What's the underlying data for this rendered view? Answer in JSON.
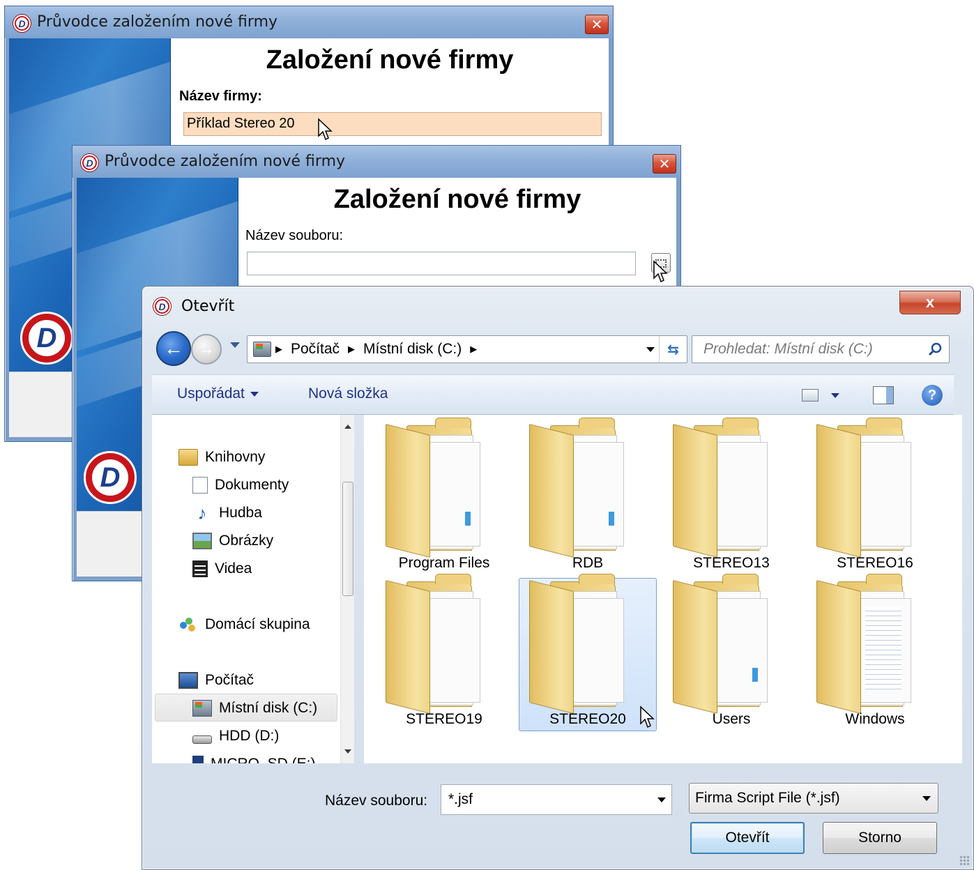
{
  "wizard1": {
    "title": "Průvodce založením nové firmy",
    "heading": "Založení nové firmy",
    "field_label": "Název firmy:",
    "field_value": "Příklad Stereo 20"
  },
  "wizard2": {
    "title": "Průvodce založením nové firmy",
    "heading": "Založení nové firmy",
    "field_label": "Název souboru:",
    "field_value": ""
  },
  "dialog": {
    "title": "Otevřít",
    "close_label": "x",
    "breadcrumb": [
      "Počítač",
      "Místní disk (C:)"
    ],
    "search_placeholder": "Prohledat: Místní disk (C:)",
    "toolbar": {
      "organize": "Uspořádat",
      "new_folder": "Nová složka"
    },
    "nav": {
      "libraries": "Knihovny",
      "documents": "Dokumenty",
      "music": "Hudba",
      "pictures": "Obrázky",
      "videos": "Videa",
      "homegroup": "Domácí skupina",
      "computer": "Počítač",
      "local_disk": "Místní disk (C:)",
      "hdd": "HDD (D:)",
      "micro_sd": "MICRO_SD (E:)"
    },
    "files": [
      {
        "name": "Program Files",
        "style": "full"
      },
      {
        "name": "RDB",
        "style": "full"
      },
      {
        "name": "STEREO13",
        "style": "empty"
      },
      {
        "name": "STEREO16",
        "style": "empty"
      },
      {
        "name": "STEREO19",
        "style": "empty"
      },
      {
        "name": "STEREO20",
        "style": "empty",
        "selected": true
      },
      {
        "name": "Users",
        "style": "full"
      },
      {
        "name": "Windows",
        "style": "lines"
      }
    ],
    "filename_label": "Název souboru:",
    "filename_value": "*.jsf",
    "filetype_value": "Firma Script File (*.jsf)",
    "open_button": "Otevřít",
    "cancel_button": "Storno"
  },
  "colors": {
    "accent_blue": "#1e3287",
    "selection": "#cfe2fa",
    "input_highlight": "#fdddc0",
    "brand_red": "#c8141b"
  }
}
